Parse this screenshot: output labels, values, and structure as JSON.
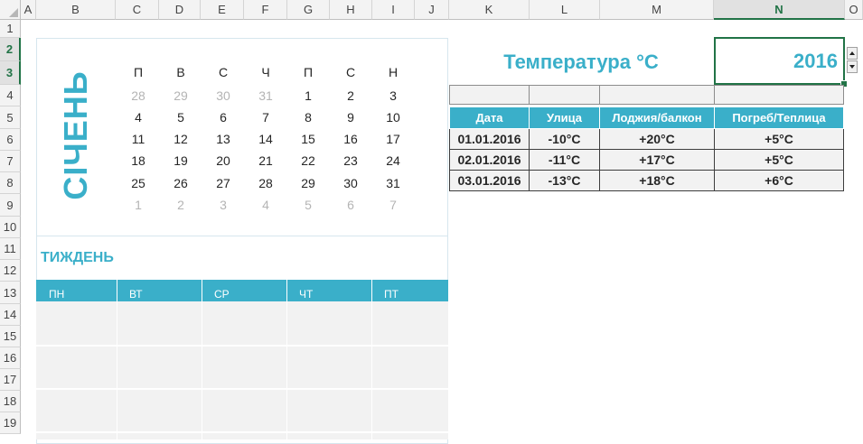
{
  "sheet": {
    "columns": [
      "A",
      "B",
      "C",
      "D",
      "E",
      "F",
      "G",
      "H",
      "I",
      "J",
      "K",
      "L",
      "M",
      "N",
      "O"
    ],
    "selected_column": "N",
    "rows": [
      "1",
      "2",
      "3",
      "4",
      "5",
      "6",
      "7",
      "8",
      "9",
      "10",
      "11",
      "12",
      "13",
      "14",
      "15",
      "16",
      "17",
      "18",
      "19"
    ],
    "selected_rows": [
      "2",
      "3"
    ]
  },
  "calendar": {
    "month": "СІЧЕНЬ",
    "weekdays": [
      "П",
      "В",
      "С",
      "Ч",
      "П",
      "С",
      "Н"
    ],
    "weeks": [
      [
        {
          "d": "28",
          "other": true
        },
        {
          "d": "29",
          "other": true
        },
        {
          "d": "30",
          "other": true
        },
        {
          "d": "31",
          "other": true
        },
        {
          "d": "1"
        },
        {
          "d": "2"
        },
        {
          "d": "3"
        }
      ],
      [
        {
          "d": "4"
        },
        {
          "d": "5"
        },
        {
          "d": "6"
        },
        {
          "d": "7"
        },
        {
          "d": "8"
        },
        {
          "d": "9"
        },
        {
          "d": "10"
        }
      ],
      [
        {
          "d": "11"
        },
        {
          "d": "12"
        },
        {
          "d": "13"
        },
        {
          "d": "14"
        },
        {
          "d": "15"
        },
        {
          "d": "16"
        },
        {
          "d": "17"
        }
      ],
      [
        {
          "d": "18"
        },
        {
          "d": "19"
        },
        {
          "d": "20"
        },
        {
          "d": "21"
        },
        {
          "d": "22"
        },
        {
          "d": "23"
        },
        {
          "d": "24"
        }
      ],
      [
        {
          "d": "25"
        },
        {
          "d": "26"
        },
        {
          "d": "27"
        },
        {
          "d": "28"
        },
        {
          "d": "29"
        },
        {
          "d": "30"
        },
        {
          "d": "31"
        }
      ],
      [
        {
          "d": "1",
          "other": true
        },
        {
          "d": "2",
          "other": true
        },
        {
          "d": "3",
          "other": true
        },
        {
          "d": "4",
          "other": true
        },
        {
          "d": "5",
          "other": true
        },
        {
          "d": "6",
          "other": true
        },
        {
          "d": "7",
          "other": true
        }
      ]
    ]
  },
  "week": {
    "title": "ТИЖДЕНЬ",
    "days": [
      "ПН",
      "ВТ",
      "СР",
      "ЧТ",
      "ПТ"
    ]
  },
  "temperature": {
    "title": "Температура °C",
    "year": "2016",
    "headers": [
      "Дата",
      "Улица",
      "Лоджия/балкон",
      "Погреб/Теплица"
    ],
    "rows": [
      [
        "01.01.2016",
        "-10°C",
        "+20°C",
        "+5°C"
      ],
      [
        "02.01.2016",
        "-11°C",
        "+17°C",
        "+5°C"
      ],
      [
        "03.01.2016",
        "-13°C",
        "+18°C",
        "+6°C"
      ]
    ]
  },
  "colors": {
    "accent": "#3aafc9",
    "selection": "#217346",
    "cell_fill": "#f2f2f2",
    "muted_day": "#b4b4b4"
  }
}
